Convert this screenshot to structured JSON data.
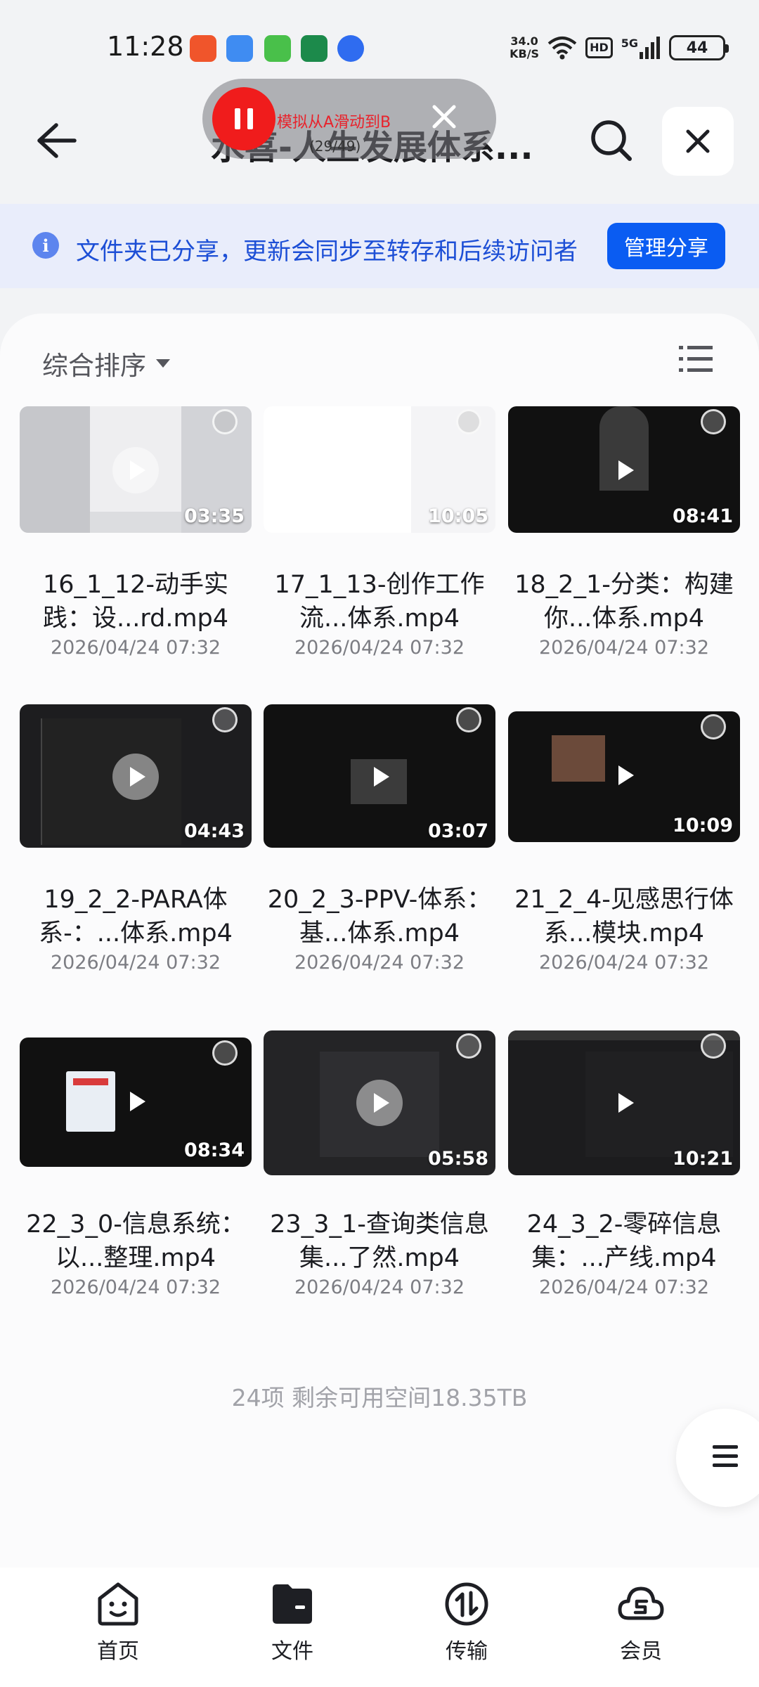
{
  "status_bar": {
    "time": "11:28",
    "net_speed_value": "34.0",
    "net_speed_unit": "KB/S",
    "hd": "HD",
    "signal": "5G",
    "battery": "44"
  },
  "header": {
    "title": "水喜-人生发展体系...",
    "icons": [
      "back-arrow-icon",
      "search-icon",
      "close-icon"
    ]
  },
  "recorder": {
    "label": "模拟从A滑动到B",
    "counter": "(29/49)"
  },
  "share_banner": {
    "text": "文件夹已分享，更新会同步至转存和后续访问者",
    "button": "管理分享"
  },
  "sort": {
    "label": "综合排序"
  },
  "files": [
    {
      "name": "16_1_12-动手实践：设...rd.mp4",
      "date": "2026/04/24 07:32",
      "duration": "03:35"
    },
    {
      "name": "17_1_13-创作工作流...体系.mp4",
      "date": "2026/04/24 07:32",
      "duration": "10:05"
    },
    {
      "name": "18_2_1-分类：构建你...体系.mp4",
      "date": "2026/04/24 07:32",
      "duration": "08:41"
    },
    {
      "name": "19_2_2-PARA体系-：...体系.mp4",
      "date": "2026/04/24 07:32",
      "duration": "04:43"
    },
    {
      "name": "20_2_3-PPV-体系：基...体系.mp4",
      "date": "2026/04/24 07:32",
      "duration": "03:07"
    },
    {
      "name": "21_2_4-见感思行体系...模块.mp4",
      "date": "2026/04/24 07:32",
      "duration": "10:09"
    },
    {
      "name": "22_3_0-信息系统：以...整理.mp4",
      "date": "2026/04/24 07:32",
      "duration": "08:34"
    },
    {
      "name": "23_3_1-查询类信息集...了然.mp4",
      "date": "2026/04/24 07:32",
      "duration": "05:58"
    },
    {
      "name": "24_3_2-零碎信息集：...产线.mp4",
      "date": "2026/04/24 07:32",
      "duration": "10:21"
    }
  ],
  "footer": {
    "summary": "24项 剩余可用空间18.35TB"
  },
  "bottom_nav": [
    {
      "label": "首页",
      "icon": "home-face-icon"
    },
    {
      "label": "文件",
      "icon": "folder-icon"
    },
    {
      "label": "传输",
      "icon": "transfer-icon"
    },
    {
      "label": "会员",
      "icon": "membership-cloud-icon"
    }
  ]
}
